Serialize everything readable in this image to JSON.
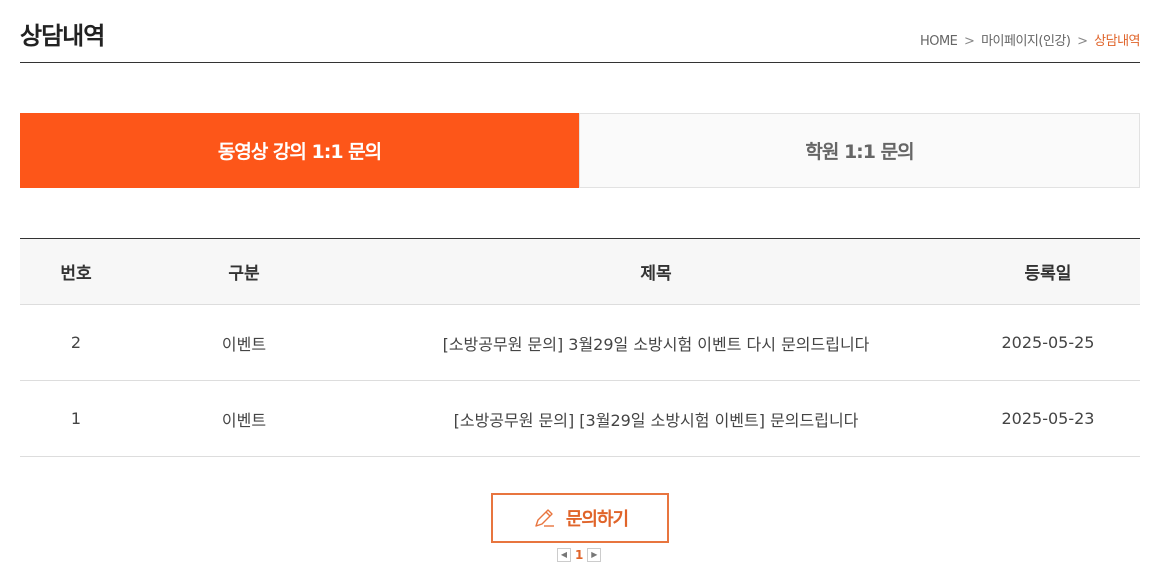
{
  "header": {
    "title": "상담내역",
    "breadcrumb": {
      "home": "HOME",
      "sep1": ">",
      "mypage": "마이페이지(인강)",
      "sep2": ">",
      "current": "상담내역"
    }
  },
  "tabs": [
    {
      "label": "동영상 강의 1:1 문의",
      "active": true
    },
    {
      "label": "학원 1:1 문의",
      "active": false
    }
  ],
  "table": {
    "headers": [
      "번호",
      "구분",
      "제목",
      "등록일"
    ],
    "rows": [
      {
        "no": "2",
        "category": "이벤트",
        "title": "[소방공무원 문의] 3월29일 소방시험 이벤트 다시 문의드립니다",
        "date": "2025-05-25"
      },
      {
        "no": "1",
        "category": "이벤트",
        "title": "[소방공무원 문의] [3월29일 소방시험 이벤트] 문의드립니다",
        "date": "2025-05-23"
      }
    ]
  },
  "write_button": {
    "label": "문의하기",
    "icon": "pencil-icon"
  },
  "pagination": {
    "current_page": "1",
    "prev_icon": "prev-arrow-icon",
    "next_icon": "next-arrow-icon"
  },
  "colors": {
    "accent": "#fd5619",
    "accent_text": "#e0642a",
    "tab_inactive_bg": "#fafafa"
  }
}
